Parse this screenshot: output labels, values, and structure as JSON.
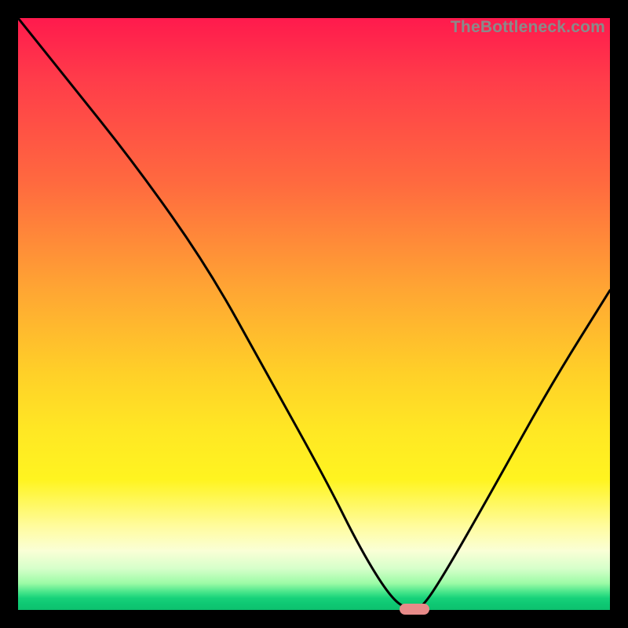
{
  "watermark": "TheBottleneck.com",
  "colors": {
    "frame": "#000000",
    "gradient_top": "#ff1a4d",
    "gradient_mid": "#ffd028",
    "gradient_bottom": "#0dc06e",
    "curve": "#000000",
    "marker": "#e78b89"
  },
  "chart_data": {
    "type": "line",
    "title": "",
    "xlabel": "",
    "ylabel": "",
    "xlim": [
      0,
      100
    ],
    "ylim": [
      0,
      100
    ],
    "series": [
      {
        "name": "bottleneck-curve",
        "x": [
          0,
          8,
          20,
          32,
          42,
          52,
          58,
          63,
          66,
          68,
          72,
          80,
          90,
          100
        ],
        "values": [
          100,
          90,
          75,
          58,
          40,
          22,
          10,
          2,
          0,
          0,
          6,
          20,
          38,
          54
        ]
      }
    ],
    "marker": {
      "x": 67,
      "y": 0,
      "width_pct": 5
    },
    "grid": false,
    "legend": false
  }
}
